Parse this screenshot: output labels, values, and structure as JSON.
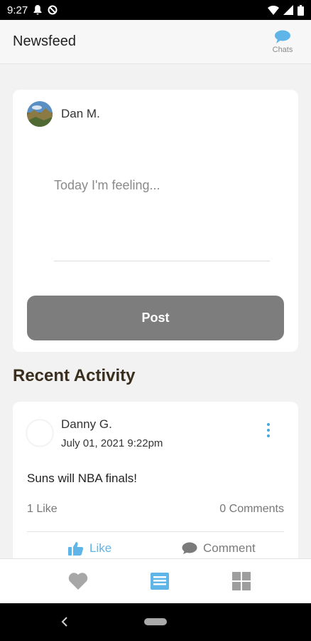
{
  "status_bar": {
    "time": "9:27"
  },
  "header": {
    "title": "Newsfeed",
    "chats_label": "Chats"
  },
  "compose": {
    "user_name": "Dan M.",
    "placeholder": "Today I'm feeling...",
    "post_button": "Post"
  },
  "recent_activity": {
    "title": "Recent Activity",
    "posts": [
      {
        "author": "Danny G.",
        "timestamp": "July 01, 2021 9:22pm",
        "text": "Suns will NBA finals!",
        "likes": "1 Like",
        "comments": "0 Comments",
        "like_action": "Like",
        "comment_action": "Comment"
      }
    ]
  },
  "bottom_tabs": [
    {
      "icon": "heart-icon"
    },
    {
      "icon": "newsfeed-icon",
      "active": true
    },
    {
      "icon": "grid-icon"
    }
  ],
  "colors": {
    "accent": "#5fb4e8",
    "post_button": "#7d7d7d",
    "section_title": "#3a2f1f"
  }
}
